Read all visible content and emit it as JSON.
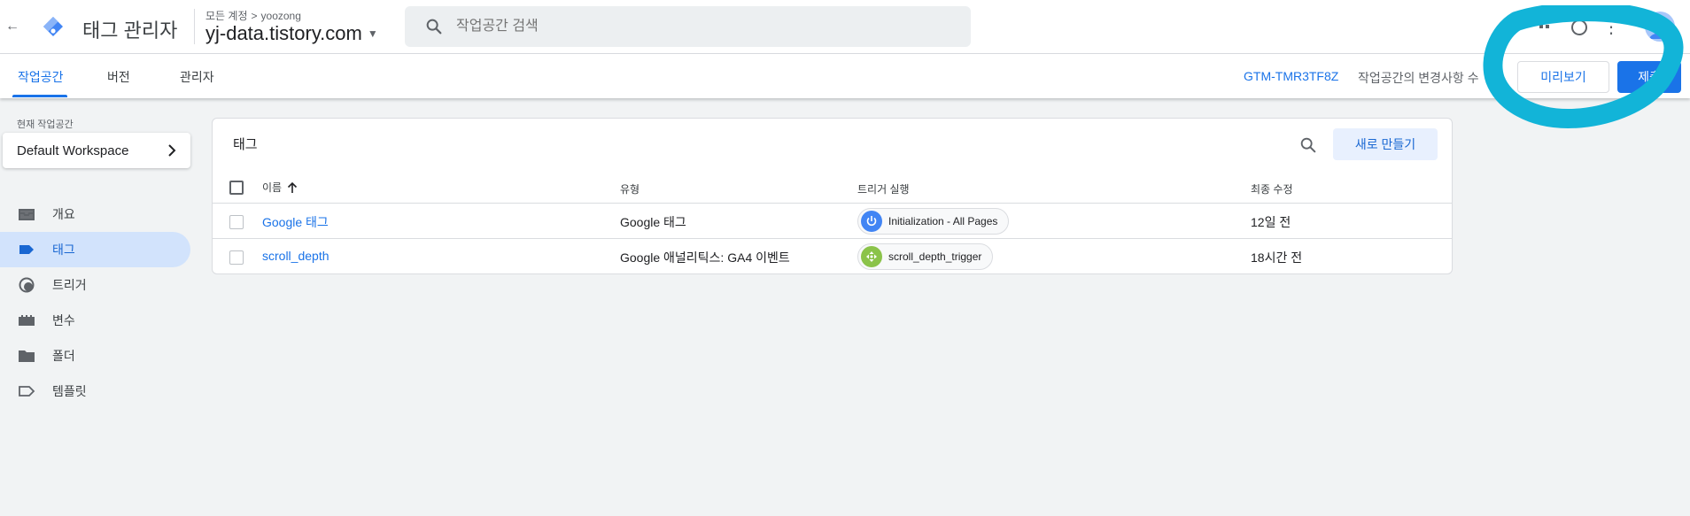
{
  "header": {
    "app_title": "태그 관리자",
    "breadcrumb": {
      "account_label": "모든 계정",
      "separator": ">",
      "account_name": "yoozong"
    },
    "container_name": "yj-data.tistory.com",
    "search_placeholder": "작업공간 검색"
  },
  "tabs": [
    {
      "label": "작업공간",
      "active": true
    },
    {
      "label": "버전",
      "active": false
    },
    {
      "label": "관리자",
      "active": false
    }
  ],
  "toolbar": {
    "gtm_id": "GTM-TMR3TF8Z",
    "changes_text": "작업공간의 변경사항 수",
    "preview_label": "미리보기",
    "submit_label": "제출"
  },
  "sidebar": {
    "workspace_label": "현재 작업공간",
    "workspace_name": "Default Workspace",
    "items": [
      {
        "label": "개요",
        "icon": "overview-icon",
        "active": false
      },
      {
        "label": "태그",
        "icon": "tag-icon",
        "active": true
      },
      {
        "label": "트리거",
        "icon": "trigger-icon",
        "active": false
      },
      {
        "label": "변수",
        "icon": "variable-icon",
        "active": false
      },
      {
        "label": "폴더",
        "icon": "folder-icon",
        "active": false
      },
      {
        "label": "템플릿",
        "icon": "template-icon",
        "active": false
      }
    ]
  },
  "tags_card": {
    "title": "태그",
    "new_button": "새로 만들기",
    "columns": {
      "name": "이름",
      "type": "유형",
      "trigger": "트리거 실행",
      "modified": "최종 수정"
    },
    "rows": [
      {
        "name": "Google 태그",
        "type": "Google 태그",
        "trigger": "Initialization - All Pages",
        "trigger_icon": "power-icon",
        "modified": "12일 전"
      },
      {
        "name": "scroll_depth",
        "type": "Google 애널리틱스: GA4 이벤트",
        "trigger": "scroll_depth_trigger",
        "trigger_icon": "scroll-icon",
        "modified": "18시간 전"
      }
    ]
  },
  "colors": {
    "accent": "#1a73e8",
    "active_nav_bg": "#d2e3fc",
    "annotation": "#12b4d8",
    "power_chip": "#4285f4",
    "scroll_chip": "#8bc34a"
  }
}
